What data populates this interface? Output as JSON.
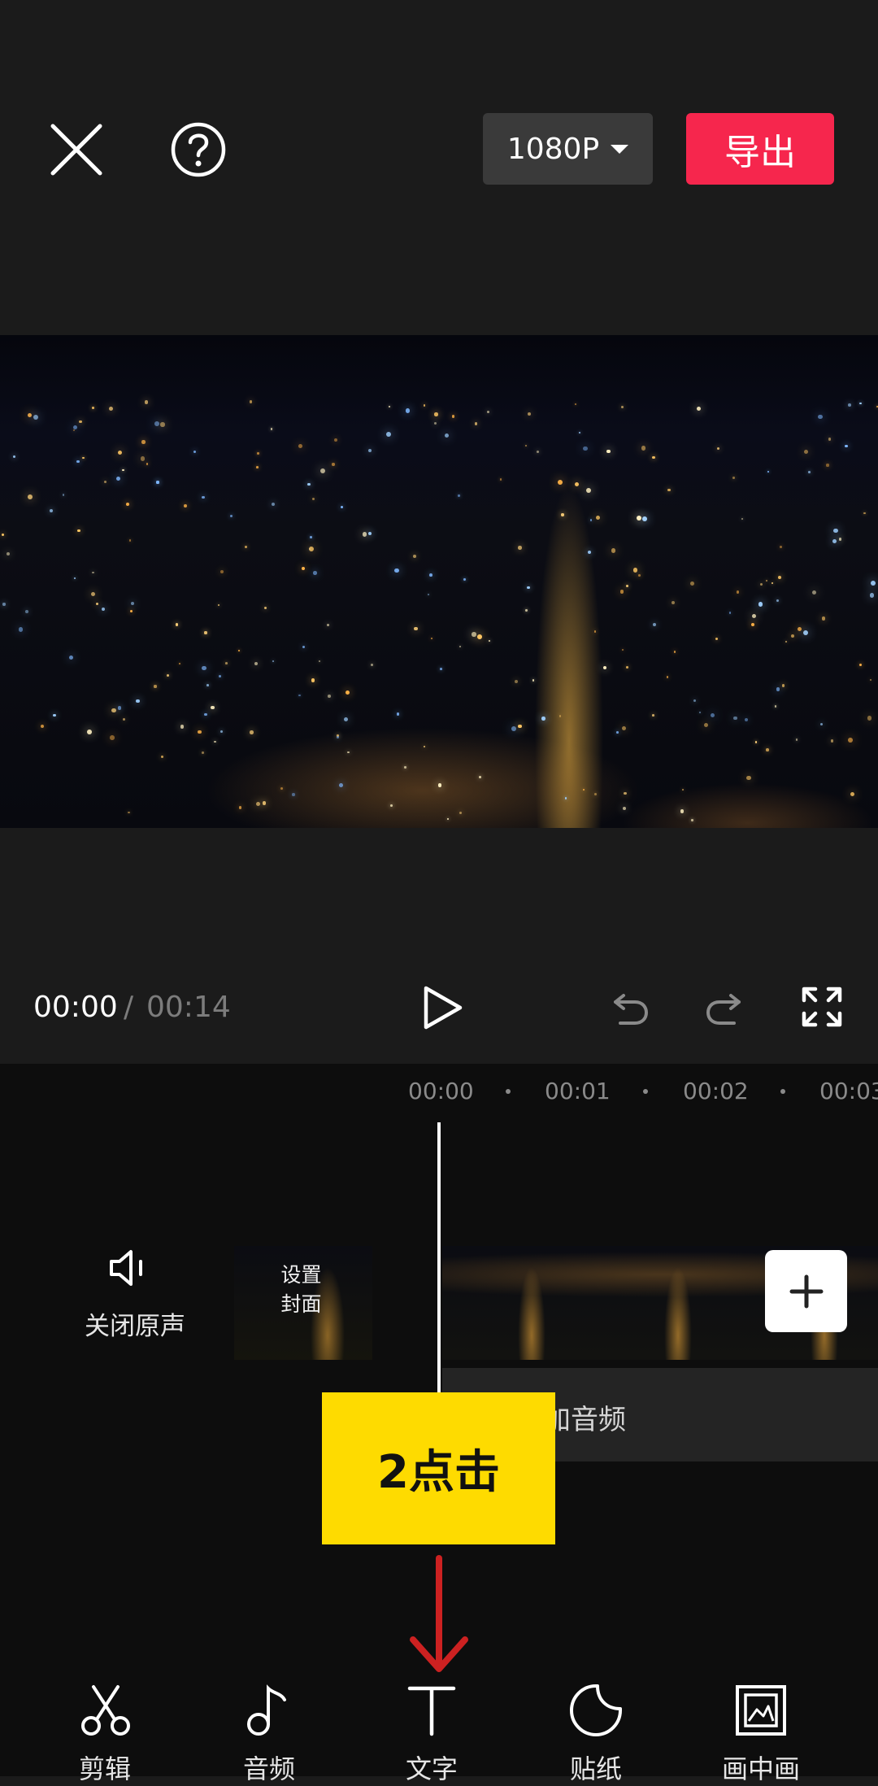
{
  "header": {
    "close_icon": "close-icon",
    "help_icon": "help-icon",
    "resolution": "1080P",
    "export_label": "导出"
  },
  "playback": {
    "current_time": "00:00",
    "separator": "/",
    "total_time": "00:14"
  },
  "timeline": {
    "ticks": [
      "00:00",
      "00:01",
      "00:02",
      "00:03"
    ],
    "mute_label": "关闭原声",
    "cover_label_line1": "设置",
    "cover_label_line2": "封面",
    "audio_label": "加音频"
  },
  "annotation": {
    "text": "2点击",
    "arrow_color": "#cc2121"
  },
  "toolbar": {
    "items": [
      {
        "label": "剪辑",
        "icon": "scissors-icon"
      },
      {
        "label": "音频",
        "icon": "music-note-icon"
      },
      {
        "label": "文字",
        "icon": "text-icon"
      },
      {
        "label": "贴纸",
        "icon": "sticker-icon"
      },
      {
        "label": "画中画",
        "icon": "picture-in-picture-icon"
      }
    ]
  },
  "colors": {
    "export": "#f6264d",
    "annotation": "#fedb00",
    "background": "#1b1b1b"
  }
}
